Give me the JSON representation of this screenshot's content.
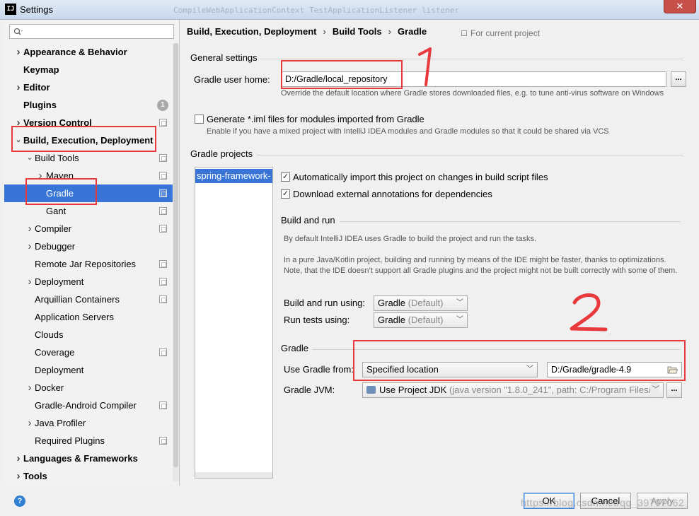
{
  "window": {
    "app_icon_text": "IJ",
    "title": "Settings",
    "close_glyph": "✕",
    "blurred_background_text": "CompileWebApplicationContext TestApplicationListener listener"
  },
  "search": {
    "placeholder": ""
  },
  "sidebar": {
    "items": [
      {
        "label": "Appearance & Behavior",
        "bold": true,
        "indent": 0,
        "chevron": "right"
      },
      {
        "label": "Keymap",
        "bold": true,
        "indent": 0,
        "chevron": ""
      },
      {
        "label": "Editor",
        "bold": true,
        "indent": 0,
        "chevron": "right"
      },
      {
        "label": "Plugins",
        "bold": true,
        "indent": 0,
        "chevron": "",
        "badge": "1"
      },
      {
        "label": "Version Control",
        "bold": true,
        "indent": 0,
        "chevron": "right",
        "project_icon": true
      },
      {
        "label": "Build, Execution, Deployment",
        "bold": true,
        "indent": 0,
        "chevron": "down"
      },
      {
        "label": "Build Tools",
        "bold": false,
        "indent": 1,
        "chevron": "down",
        "project_icon": true
      },
      {
        "label": "Maven",
        "bold": false,
        "indent": 2,
        "chevron": "right",
        "project_icon": true
      },
      {
        "label": "Gradle",
        "bold": false,
        "indent": 2,
        "chevron": "",
        "project_icon": true,
        "selected": true
      },
      {
        "label": "Gant",
        "bold": false,
        "indent": 2,
        "chevron": "",
        "project_icon": true
      },
      {
        "label": "Compiler",
        "bold": false,
        "indent": 1,
        "chevron": "right",
        "project_icon": true
      },
      {
        "label": "Debugger",
        "bold": false,
        "indent": 1,
        "chevron": "right"
      },
      {
        "label": "Remote Jar Repositories",
        "bold": false,
        "indent": 1,
        "chevron": "",
        "project_icon": true
      },
      {
        "label": "Deployment",
        "bold": false,
        "indent": 1,
        "chevron": "right",
        "project_icon": true
      },
      {
        "label": "Arquillian Containers",
        "bold": false,
        "indent": 1,
        "chevron": "",
        "project_icon": true
      },
      {
        "label": "Application Servers",
        "bold": false,
        "indent": 1,
        "chevron": ""
      },
      {
        "label": "Clouds",
        "bold": false,
        "indent": 1,
        "chevron": ""
      },
      {
        "label": "Coverage",
        "bold": false,
        "indent": 1,
        "chevron": "",
        "project_icon": true
      },
      {
        "label": "Deployment",
        "bold": false,
        "indent": 1,
        "chevron": ""
      },
      {
        "label": "Docker",
        "bold": false,
        "indent": 1,
        "chevron": "right"
      },
      {
        "label": "Gradle-Android Compiler",
        "bold": false,
        "indent": 1,
        "chevron": "",
        "project_icon": true
      },
      {
        "label": "Java Profiler",
        "bold": false,
        "indent": 1,
        "chevron": "right"
      },
      {
        "label": "Required Plugins",
        "bold": false,
        "indent": 1,
        "chevron": "",
        "project_icon": true
      },
      {
        "label": "Languages & Frameworks",
        "bold": true,
        "indent": 0,
        "chevron": "right"
      },
      {
        "label": "Tools",
        "bold": true,
        "indent": 0,
        "chevron": "right"
      }
    ]
  },
  "breadcrumb": {
    "parts": [
      "Build, Execution, Deployment",
      "Build Tools",
      "Gradle"
    ],
    "separator": "›",
    "scope_note": "For current project"
  },
  "general": {
    "title": "General settings",
    "user_home_label": "Gradle user home:",
    "user_home_value": "D:/Gradle/local_repository",
    "browse_label": "...",
    "user_home_hint": "Override the default location where Gradle stores downloaded files, e.g. to tune anti-virus software on Windows",
    "iml_label": "Generate *.iml files for modules imported from Gradle",
    "iml_checked": false,
    "iml_hint": "Enable if you have a mixed project with IntelliJ IDEA modules and Gradle modules so that it could be shared via VCS"
  },
  "projects": {
    "title": "Gradle projects",
    "list": [
      "spring-framework-"
    ],
    "auto_import_label": "Automatically import this project on changes in build script files",
    "auto_import_checked": true,
    "download_annotations_label": "Download external annotations for dependencies",
    "download_annotations_checked": true
  },
  "build_run": {
    "title": "Build and run",
    "desc1": "By default IntelliJ IDEA uses Gradle to build the project and run the tasks.",
    "desc2": "In a pure Java/Kotlin project, building and running by means of the IDE might be faster, thanks to optimizations. Note, that the IDE doesn’t support all Gradle plugins and the project might not be built correctly with some of them.",
    "build_using_label": "Build and run using:",
    "build_using_value": "Gradle",
    "build_using_suffix": "(Default)",
    "tests_using_label": "Run tests using:",
    "tests_using_value": "Gradle",
    "tests_using_suffix": "(Default)"
  },
  "gradle": {
    "title": "Gradle",
    "use_from_label": "Use Gradle from:",
    "use_from_value": "Specified location",
    "location_value": "D:/Gradle/gradle-4.9",
    "jvm_label": "Gradle JVM:",
    "jvm_value": "Use Project JDK",
    "jvm_detail": "(java version \"1.8.0_241\", path: C:/Program Files/J",
    "jvm_browse": "..."
  },
  "annotations": {
    "mark1": "1",
    "mark2": "2",
    "color": "#e8393c"
  },
  "footer": {
    "help": "?",
    "ok": "OK",
    "cancel": "Cancel",
    "apply": "Apply",
    "watermark": "https://blog.csdn.net/qq_39707062"
  },
  "colors": {
    "selection": "#3875d7",
    "annotation_red": "#e8393c"
  }
}
